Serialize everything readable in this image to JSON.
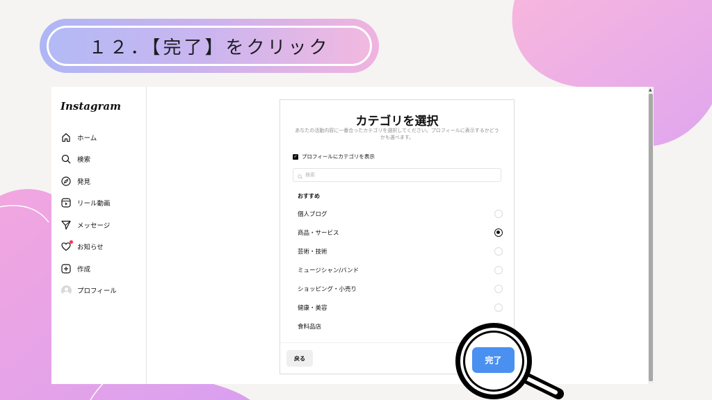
{
  "step": {
    "title": "１２．【完了】をクリック"
  },
  "sidebar": {
    "logo": "Instagram",
    "items": [
      {
        "label": "ホーム",
        "icon": "home-icon"
      },
      {
        "label": "検索",
        "icon": "search-icon"
      },
      {
        "label": "発見",
        "icon": "compass-icon"
      },
      {
        "label": "リール動画",
        "icon": "reels-icon"
      },
      {
        "label": "メッセージ",
        "icon": "send-icon"
      },
      {
        "label": "お知らせ",
        "icon": "heart-icon"
      },
      {
        "label": "作成",
        "icon": "plus-square-icon"
      },
      {
        "label": "プロフィール",
        "icon": "avatar-icon"
      }
    ]
  },
  "panel": {
    "title": "カテゴリを選択",
    "description": "あなたの活動内容に一番合ったカテゴリを選択してください。プロフィールに表示するかどうかも選べます。",
    "show_category_label": "プロフィールにカテゴリを表示",
    "show_category_checked": true,
    "search_placeholder": "検索",
    "section_heading": "おすすめ",
    "categories": [
      {
        "label": "個人ブログ",
        "selected": false
      },
      {
        "label": "商品・サービス",
        "selected": true
      },
      {
        "label": "芸術・技術",
        "selected": false
      },
      {
        "label": "ミュージシャン/バンド",
        "selected": false
      },
      {
        "label": "ショッピング・小売り",
        "selected": false
      },
      {
        "label": "健康・美容",
        "selected": false
      },
      {
        "label": "食料品店",
        "selected": false
      }
    ],
    "back_label": "戻る",
    "done_label": "完了"
  },
  "colors": {
    "done_button": "#4a90f0",
    "notification_dot": "#ff2d55"
  }
}
